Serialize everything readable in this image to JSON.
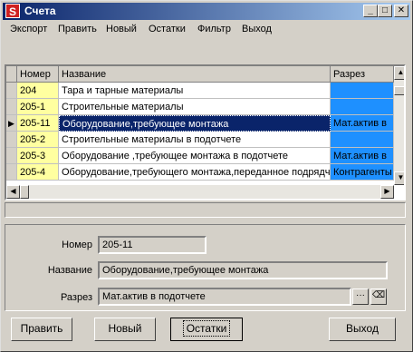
{
  "window": {
    "title": "Счета",
    "app_icon": "S"
  },
  "menu": [
    "Экспорт",
    "Править",
    "Новый",
    "Остатки",
    "Фильтр",
    "Выход"
  ],
  "grid": {
    "columns": [
      "Номер",
      "Название",
      "Разрез"
    ],
    "rows": [
      {
        "num": "204",
        "name": "Тара и тарные материалы",
        "razrez": ""
      },
      {
        "num": "205-1",
        "name": "Строительные материалы",
        "razrez": ""
      },
      {
        "num": "205-11",
        "name": "Оборудование,требующее монтажа",
        "razrez": "Мат.актив в"
      },
      {
        "num": "205-2",
        "name": "Строительные материалы в подотчете",
        "razrez": ""
      },
      {
        "num": "205-3",
        "name": "Оборудование ,требующее монтажа в подотчете",
        "razrez": "Мат.актив в"
      },
      {
        "num": "205-4",
        "name": "Оборудование,требующего монтажа,переданное подрядчи",
        "razrez": "Контрагенты"
      }
    ],
    "selected_index": 2
  },
  "detail": {
    "nomer_label": "Номер",
    "nomer_value": "205-11",
    "nazvanie_label": "Название",
    "nazvanie_value": "Оборудование,требующее монтажа",
    "razrez_label": "Разрез",
    "razrez_value": "Мат.актив в подотчете",
    "ellipsis_btn": "···"
  },
  "buttons": {
    "edit": "Править",
    "new": "Новый",
    "balances": "Остатки",
    "exit": "Выход"
  },
  "colors": {
    "num_cell": "#ffffa0",
    "razrez_cell": "#1e90ff",
    "selection": "#0a246a"
  }
}
